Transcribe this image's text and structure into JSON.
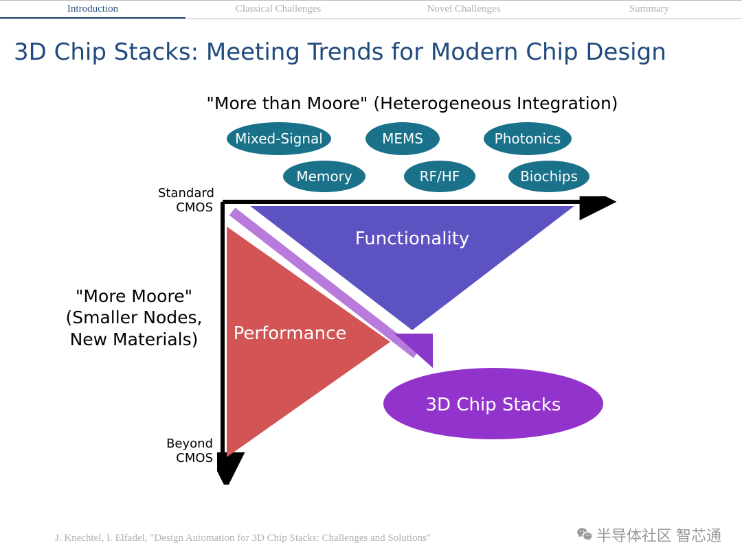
{
  "nav": {
    "items": [
      {
        "label": "Introduction",
        "active": true
      },
      {
        "label": "Classical Challenges",
        "active": false
      },
      {
        "label": "Novel Challenges",
        "active": false
      },
      {
        "label": "Summary",
        "active": false
      }
    ]
  },
  "title": "3D Chip Stacks: Meeting Trends for Modern Chip Design",
  "diagram": {
    "top_heading": "\"More than Moore\" (Heterogeneous Integration)",
    "pills_row1": [
      "Mixed-Signal",
      "MEMS",
      "Photonics"
    ],
    "pills_row2": [
      "Memory",
      "RF/HF",
      "Biochips"
    ],
    "axis_top": "Standard\nCMOS",
    "axis_bottom": "Beyond\nCMOS",
    "left_block": "\"More Moore\"\n(Smaller Nodes,\nNew Materials)",
    "functionality_label": "Functionality",
    "performance_label": "Performance",
    "result_label": "3D Chip Stacks"
  },
  "citation": "J. Knechtel, I. Elfadel, \"Design Automation for 3D Chip Stacks: Challenges and Solutions\"",
  "watermark": "半导体社区 智芯通",
  "colors": {
    "nav_active": "#204a7d",
    "pill": "#19718a",
    "performance": "#d25455",
    "functionality": "#5c52c2",
    "diagonal": "#b97bdb",
    "arrow": "#8a38c9",
    "ellipse": "#9233cc"
  }
}
